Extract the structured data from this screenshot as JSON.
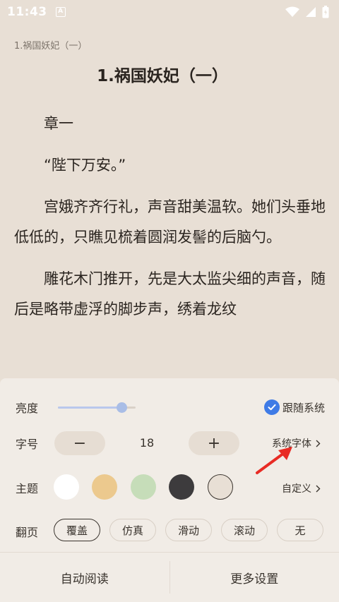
{
  "status_bar": {
    "time": "11:43",
    "notif_glyph": "A"
  },
  "reader": {
    "chapter_crumb": "1.祸国妖妃（一）",
    "chapter_title": "1.祸国妖妃（一）",
    "paragraphs": [
      "章一",
      "“陛下万安。”",
      "宫娥齐齐行礼，声音甜美温软。她们头垂地低低的，只瞧见梳着圆润发髻的后脑勺。",
      "雕花木门推开，先是大太监尖细的声音，随后是略带虚浮的脚步声，绣着龙纹"
    ]
  },
  "panel": {
    "brightness": {
      "label": "亮度",
      "level": 0.82,
      "follow_system_label": "跟随系统",
      "follow_system_checked": true
    },
    "font_size": {
      "label": "字号",
      "minus": "−",
      "value": "18",
      "plus": "+",
      "system_font_label": "系统字体"
    },
    "theme": {
      "label": "主题",
      "colors": [
        "#ffffff",
        "#ecc98e",
        "#c6ddb9",
        "#3d3b3d",
        "#e8dfd5"
      ],
      "custom_label": "自定义"
    },
    "page_turn": {
      "label": "翻页",
      "options": [
        "覆盖",
        "仿真",
        "滑动",
        "滚动",
        "无"
      ],
      "selected": "覆盖"
    },
    "bottom": {
      "auto_read": "自动阅读",
      "more_settings": "更多设置"
    }
  },
  "accent_color": "#3f7be6",
  "annotation_arrow_color": "#e82b24"
}
